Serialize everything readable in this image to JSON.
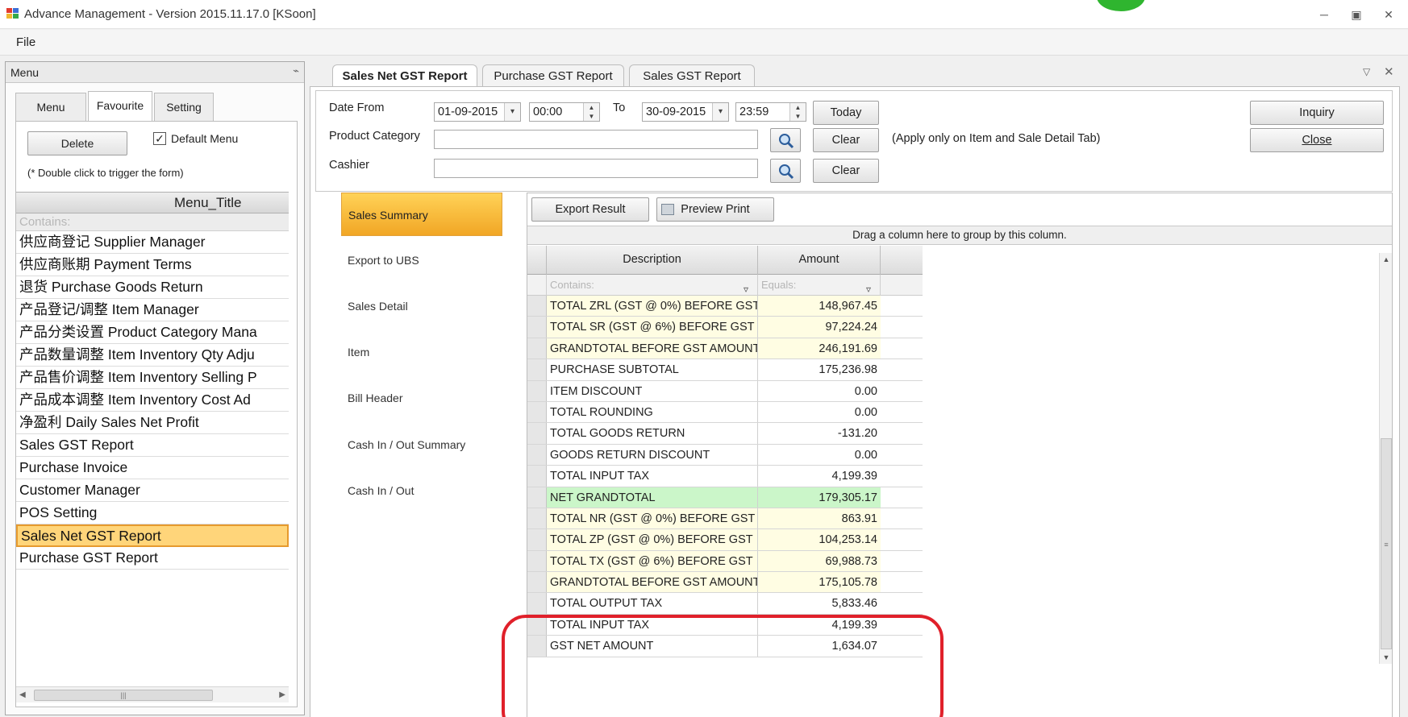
{
  "window": {
    "title": "Advance Management - Version 2015.11.17.0 [KSoon]",
    "minimize_icon": "minimize-icon",
    "maximize_icon": "maximize-icon",
    "close_icon": "close-icon"
  },
  "menubar": {
    "file": "File"
  },
  "left_panel": {
    "title": "Menu",
    "tabs": [
      {
        "label": "Menu"
      },
      {
        "label": "Favourite"
      },
      {
        "label": "Setting"
      }
    ],
    "delete_label": "Delete",
    "default_menu_label": "Default Menu",
    "default_menu_checked": true,
    "hint": "(* Double click to trigger the form)",
    "column_header": "Menu_Title",
    "filter_placeholder": "Contains:",
    "items": [
      "供应商登记 Supplier Manager",
      "供应商账期 Payment Terms",
      "退货 Purchase Goods Return",
      "产品登记/调整 Item Manager",
      "产品分类设置 Product Category Mana",
      "产品数量调整 Item Inventory Qty Adju",
      "产品售价调整 Item Inventory Selling P",
      "产品成本调整 Item Inventory Cost Ad",
      "净盈利 Daily Sales Net Profit",
      "Sales GST Report",
      "Purchase Invoice",
      "Customer Manager",
      "POS Setting",
      "Sales Net GST Report",
      "Purchase GST Report"
    ],
    "selected_item": "Sales Net GST Report"
  },
  "doc_tabs": [
    {
      "label": "Sales Net GST Report"
    },
    {
      "label": "Purchase GST Report"
    },
    {
      "label": "Sales GST Report"
    }
  ],
  "filters": {
    "date_from_label": "Date From",
    "date_from": "01-09-2015",
    "time_from": "00:00",
    "to_label": "To",
    "date_to": "30-09-2015",
    "time_to": "23:59",
    "today_label": "Today",
    "product_category_label": "Product Category",
    "product_category_value": "",
    "clear_label": "Clear",
    "apply_note": "(Apply only on Item and Sale Detail Tab)",
    "cashier_label": "Cashier",
    "cashier_value": "",
    "inquiry_label": "Inquiry",
    "close_label": "Close"
  },
  "side_tabs": [
    "Sales Summary",
    "Export to UBS",
    "Sales Detail",
    "Item",
    "Bill Header",
    "Cash In / Out Summary",
    "Cash In / Out"
  ],
  "result": {
    "export_label": "Export Result",
    "preview_label": "Preview Print",
    "group_hint": "Drag a column here to group by this column.",
    "columns": {
      "description": "Description",
      "amount": "Amount"
    },
    "filter_desc": "Contains:",
    "filter_amount": "Equals:",
    "rows": [
      {
        "description": "TOTAL ZRL (GST @ 0%) BEFORE GST",
        "amount": "148,967.45",
        "color": "yellow"
      },
      {
        "description": "TOTAL SR (GST @ 6%) BEFORE GST",
        "amount": "97,224.24",
        "color": "yellow"
      },
      {
        "description": "GRANDTOTAL BEFORE GST AMOUNT",
        "amount": "246,191.69",
        "color": "yellow"
      },
      {
        "description": "PURCHASE SUBTOTAL",
        "amount": "175,236.98",
        "color": "white"
      },
      {
        "description": "ITEM DISCOUNT",
        "amount": "0.00",
        "color": "white"
      },
      {
        "description": "TOTAL ROUNDING",
        "amount": "0.00",
        "color": "white"
      },
      {
        "description": "TOTAL GOODS RETURN",
        "amount": "-131.20",
        "color": "white"
      },
      {
        "description": "GOODS RETURN DISCOUNT",
        "amount": "0.00",
        "color": "white"
      },
      {
        "description": "TOTAL INPUT TAX",
        "amount": "4,199.39",
        "color": "white"
      },
      {
        "description": "NET GRANDTOTAL",
        "amount": "179,305.17",
        "color": "green"
      },
      {
        "description": "TOTAL NR (GST @ 0%) BEFORE GST",
        "amount": "863.91",
        "color": "yellow"
      },
      {
        "description": "TOTAL ZP (GST @ 0%) BEFORE GST",
        "amount": "104,253.14",
        "color": "yellow"
      },
      {
        "description": "TOTAL TX (GST @ 6%) BEFORE GST",
        "amount": "69,988.73",
        "color": "yellow"
      },
      {
        "description": "GRANDTOTAL BEFORE GST AMOUNT",
        "amount": "175,105.78",
        "color": "yellow"
      },
      {
        "description": "TOTAL OUTPUT TAX",
        "amount": "5,833.46",
        "color": "white"
      },
      {
        "description": "TOTAL INPUT TAX",
        "amount": "4,199.39",
        "color": "white"
      },
      {
        "description": "GST NET AMOUNT",
        "amount": "1,634.07",
        "color": "white"
      }
    ]
  },
  "colors": {
    "selection": "#ffd57a",
    "active_side_tab": "#f1a625",
    "row_yellow": "#fffde3",
    "row_green": "#cbf6c9",
    "annotation": "#e0202a"
  }
}
